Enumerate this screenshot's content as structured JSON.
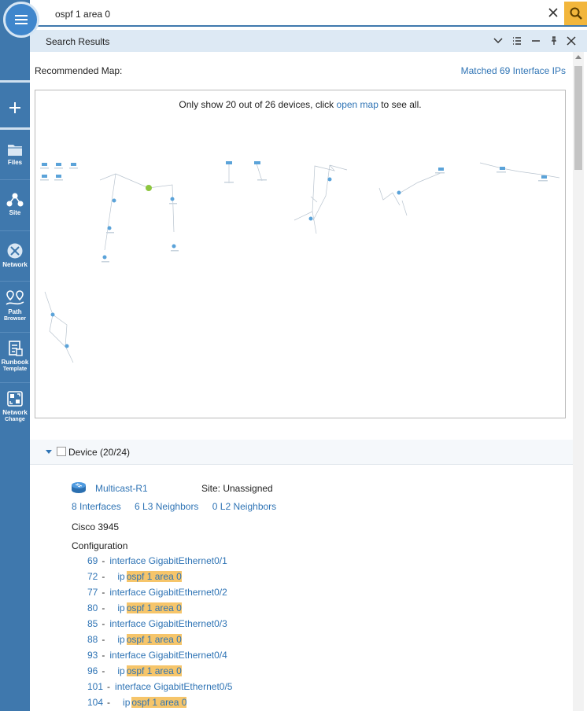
{
  "search": {
    "query": "ospf 1 area 0"
  },
  "sidebar": {
    "items": [
      {
        "label": "",
        "icon": "plus-icon"
      },
      {
        "label": "Files",
        "icon": "folder-icon"
      },
      {
        "label": "Site",
        "icon": "site-icon"
      },
      {
        "label": "Network",
        "icon": "network-icon"
      },
      {
        "label_lines": [
          "Path",
          "Browser"
        ],
        "icon": "path-icon"
      },
      {
        "label_lines": [
          "Runbook",
          "Template"
        ],
        "icon": "runbook-icon"
      },
      {
        "label_lines": [
          "Network",
          "Change"
        ],
        "icon": "network-change-icon"
      }
    ]
  },
  "panel": {
    "title": "Search Results"
  },
  "map": {
    "recommended_label": "Recommended Map:",
    "matched_link": "Matched 69 Interface IPs",
    "note_prefix": "Only show 20 out of 26 devices, click ",
    "note_link": "open map",
    "note_suffix": " to see all."
  },
  "device_section": {
    "title": "Device (20/24)"
  },
  "device": {
    "name": "Multicast-R1",
    "site": "Site: Unassigned",
    "links": [
      "8 Interfaces",
      "6 L3 Neighbors",
      "0 L2 Neighbors"
    ],
    "vendor": "Cisco  3945",
    "config_label": "Configuration",
    "config_lines": [
      {
        "line": "69",
        "text": "interface GigabitEthernet0/1",
        "kind": "interface"
      },
      {
        "line": "72",
        "prefix": "ip",
        "text": "ospf 1 area 0",
        "kind": "match"
      },
      {
        "line": "77",
        "text": "interface GigabitEthernet0/2",
        "kind": "interface"
      },
      {
        "line": "80",
        "prefix": "ip",
        "text": "ospf 1 area 0",
        "kind": "match"
      },
      {
        "line": "85",
        "text": "interface GigabitEthernet0/3",
        "kind": "interface"
      },
      {
        "line": "88",
        "prefix": "ip",
        "text": "ospf 1 area 0",
        "kind": "match"
      },
      {
        "line": "93",
        "text": "interface GigabitEthernet0/4",
        "kind": "interface"
      },
      {
        "line": "96",
        "prefix": "ip",
        "text": "ospf 1 area 0",
        "kind": "match"
      },
      {
        "line": "101",
        "text": "interface GigabitEthernet0/5",
        "kind": "interface"
      },
      {
        "line": "104",
        "prefix": "ip",
        "text": "ospf 1 area 0",
        "kind": "match"
      }
    ]
  },
  "colors": {
    "accent": "#2f74b5",
    "sidebar": "#3f78ad",
    "highlight": "#f6c56a",
    "search_button": "#f2b63c"
  }
}
